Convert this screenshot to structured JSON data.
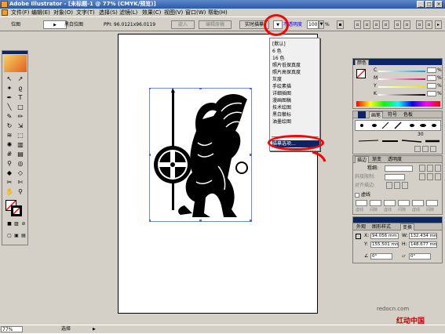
{
  "window": {
    "title": "Adobe Illustrator - [未标题-1 @ 77% (CMYK/预览)]"
  },
  "menu": [
    "文件(F)",
    "编辑(E)",
    "对象(O)",
    "文字(T)",
    "选择(S)",
    "滤镜(L)",
    "效果(C)",
    "视图(V)",
    "窗口(W)",
    "帮助(H)"
  ],
  "control": {
    "left_label": "位图",
    "mode": "黑白位图",
    "ppi": "PPI: 96.0121x96.0119",
    "embed_button": "嵌入",
    "edit_button": "编辑原稿",
    "live_trace_button": "实时描摹",
    "opacity_label": "不透明度",
    "opacity_value": "100",
    "pct": "%"
  },
  "dropdown": {
    "items": [
      "[默认]",
      "6 色",
      "16 色",
      "照片低保真度",
      "照片高保真度",
      "灰度",
      "手绘素描",
      "详细插图",
      "漫画图稿",
      "技术绘图",
      "黑白徽标",
      "油墨绘图"
    ],
    "selected": "描摹选项..."
  },
  "color_panel": {
    "tab": "颜色",
    "labels": [
      "C",
      "M",
      "Y",
      "K"
    ],
    "pct": "%"
  },
  "brush_panel": {
    "tabs": [
      "画笔",
      "符号",
      "色板"
    ],
    "stroke_label": "30"
  },
  "stroke_panel": {
    "tabs": [
      "描边",
      "渐变",
      "透明度"
    ],
    "weight_label": "粗细:",
    "cap_label": "斜接限制:",
    "align_label": "对齐描边:",
    "dash_label": "虚线",
    "dash_fields": [
      "虚线",
      "间隙",
      "虚线",
      "间隙",
      "虚线",
      "间隙"
    ]
  },
  "transform_panel": {
    "tabs": [
      "外观",
      "图形样式",
      "变换"
    ],
    "x_label": "X:",
    "x_value": "94.056 mm",
    "y_label": "Y:",
    "y_value": "155.501 mm",
    "w_label": "W:",
    "w_value": "132.434 mm",
    "h_label": "H:",
    "h_value": "148.677 mm",
    "angle_value": "0°",
    "shear_value": "0°"
  },
  "status": {
    "zoom": "77%",
    "tool": "选择"
  },
  "watermark": {
    "site": "redocn.com",
    "name": "红动中国"
  },
  "colors": {
    "title": "#2c5aa6",
    "chrome": "#d4d0c8",
    "selected": "#0a246a",
    "annotation": "#ff0000"
  }
}
